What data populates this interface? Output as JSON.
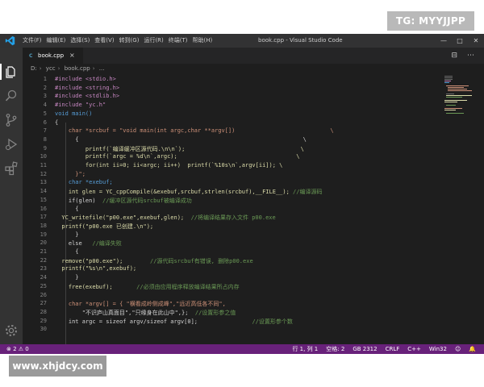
{
  "watermark_top": "TG: MYYJJPP",
  "watermark_bottom": "www.xhjdcy.com",
  "window": {
    "menu": [
      "文件(F)",
      "编辑(E)",
      "选择(S)",
      "查看(V)",
      "转到(G)",
      "运行(R)",
      "终端(T)",
      "帮助(H)"
    ],
    "title": "book.cpp - Visual Studio Code",
    "controls": [
      "—",
      "□",
      "✕"
    ]
  },
  "activity_bar": {
    "icons": [
      "files-icon",
      "search-icon",
      "source-control-icon",
      "run-debug-icon",
      "extensions-icon",
      "settings-gear-icon"
    ]
  },
  "tab": {
    "label": "book.cpp",
    "close": "×",
    "actions": [
      "⊟",
      "⋯"
    ]
  },
  "breadcrumbs": [
    "D:",
    "ycc",
    "book.cpp",
    "..."
  ],
  "editor": {
    "lines": [
      {
        "n": "1",
        "text": "#include <stdio.h>"
      },
      {
        "n": "2",
        "text": "#include <string.h>"
      },
      {
        "n": "3",
        "text": "#include <stdlib.h>"
      },
      {
        "n": "4",
        "text": "#include \"yc.h\""
      },
      {
        "n": "5",
        "text": "void main()"
      },
      {
        "n": "6",
        "text": "{"
      },
      {
        "n": "7",
        "text": "    char *srcbuf = \"void main(int argc,char **argv[])                            \\"
      },
      {
        "n": "8",
        "text": "      {                                                                  \\"
      },
      {
        "n": "9",
        "text": "         printf(`编译缓冲区源代码.\\n\\n`);                                  \\"
      },
      {
        "n": "10",
        "text": "         printf(`argc = %d\\n`,argc);                                   \\"
      },
      {
        "n": "11",
        "text": "         for(int ii=0; ii<argc; ii++)  printf(`%10s\\n`,argv[ii]); \\"
      },
      {
        "n": "12",
        "text": "      }\";"
      },
      {
        "n": "13",
        "text": "    char *exebuf;"
      },
      {
        "n": "14",
        "text": "    int glen = YC_cppCompile(&exebuf,srcbuf,strlen(srcbuf),__FILE__); //编译源码"
      },
      {
        "n": "15",
        "text": "    if(glen)  //缓冲区源代码srcbuf被编译成功"
      },
      {
        "n": "16",
        "text": "      {"
      },
      {
        "n": "17",
        "text": "  YC_writefile(\"p00.exe\",exebuf,glen);  //将编译结果存入文件 p00.exe"
      },
      {
        "n": "18",
        "text": "  printf(\"p00.exe 已创建.\\n\");"
      },
      {
        "n": "19",
        "text": "      }"
      },
      {
        "n": "20",
        "text": "    else   //编译失败"
      },
      {
        "n": "21",
        "text": "      {"
      },
      {
        "n": "22",
        "text": "  remove(\"p00.exe\");        //源代码srcbuf有错误, 删除p00.exe"
      },
      {
        "n": "23",
        "text": "  printf(\"%s\\n\",exebuf);"
      },
      {
        "n": "24",
        "text": "      }"
      },
      {
        "n": "25",
        "text": "    free(exebuf);       //必须由应用程序释放编译结果所占内存"
      },
      {
        "n": "26",
        "text": ""
      },
      {
        "n": "27",
        "text": "    char *argv[] = { \"横看成岭侧成峰\",\"远近高低各不同\","
      },
      {
        "n": "28",
        "text": "        \"不识庐山真面目\",\"只缘身在此山中\",};  //设置形参之值"
      },
      {
        "n": "29",
        "text": "    int argc = sizeof argv/sizeof argv[0];                //设置形参个数"
      },
      {
        "n": "30",
        "text": ""
      }
    ]
  },
  "status": {
    "left": "⊗ 2 ⚠ 0",
    "right": [
      "行 1, 列 1",
      "空格: 2",
      "GB 2312",
      "CRLF",
      "C++",
      "Win32",
      "☺",
      "🔔"
    ]
  },
  "colors": {
    "titlebar": "#323233",
    "activity_bar": "#333333",
    "editor_bg": "#1e1e1e",
    "statusbar": "#68217a",
    "keyword": "#569cd6",
    "string": "#ce9178",
    "comment": "#6a9955",
    "function": "#dcdcaa",
    "preprocessor": "#c586c0"
  }
}
